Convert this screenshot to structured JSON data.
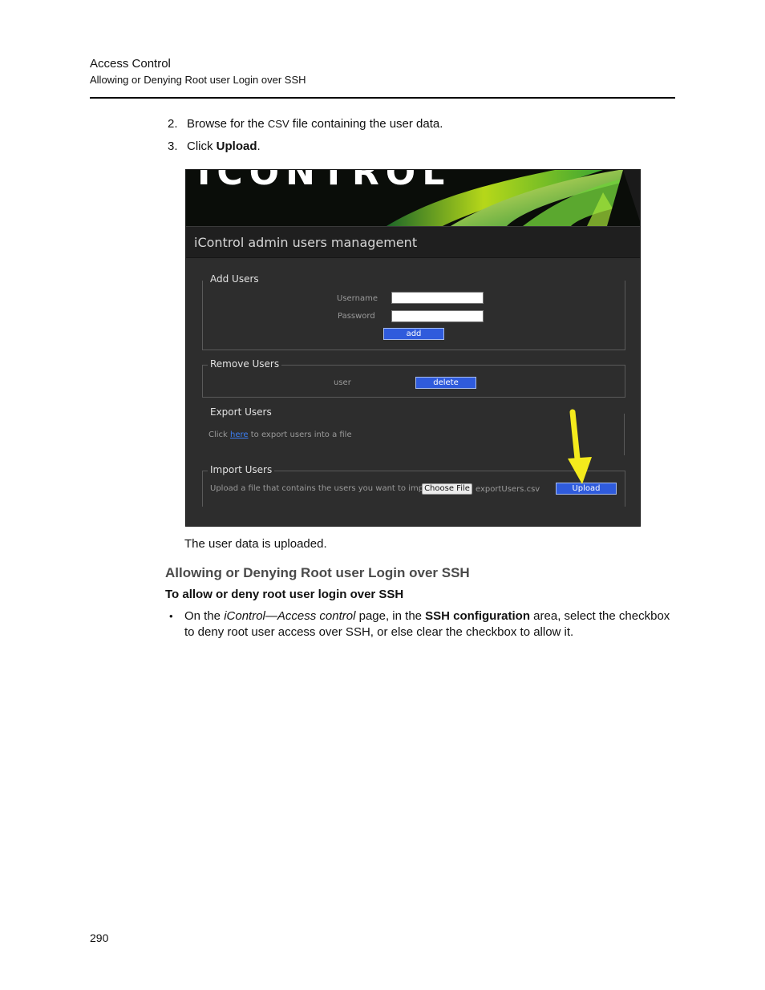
{
  "header": {
    "chapter": "Access Control",
    "section": "Allowing or Denying Root user Login over SSH"
  },
  "steps": [
    {
      "num": "2.",
      "pre": "Browse for the ",
      "code": "CSV",
      "post": " file containing the user data."
    },
    {
      "num": "3.",
      "pre": "Click ",
      "bold": "Upload",
      "post": "."
    }
  ],
  "screenshot": {
    "banner_text": "ICONTROL",
    "app_title": "iControl admin users management",
    "add_users": {
      "legend": "Add Users",
      "username_label": "Username",
      "password_label": "Password",
      "add_button": "add"
    },
    "remove_users": {
      "legend": "Remove Users",
      "user_label": "user",
      "delete_button": "delete"
    },
    "export_users": {
      "legend": "Export Users",
      "text_pre": "Click ",
      "link": "here",
      "text_post": " to export users into a file"
    },
    "import_users": {
      "legend": "Import Users",
      "text": "Upload a file that contains the users you want to import",
      "choose_button": "Choose File",
      "file_name": "exportUsers.csv",
      "upload_button": "Upload"
    },
    "colors": {
      "accent_button": "#2f5bdc",
      "arrow": "#f4ea1c"
    }
  },
  "result_text": "The user data is uploaded.",
  "section_heading": "Allowing or Denying Root user Login over SSH",
  "procedure_heading": "To allow or deny root user login over SSH",
  "bullet": {
    "t1": "On the ",
    "i1": "iControl—Access control",
    "t2": " page, in the ",
    "b1": "SSH  configuration",
    "t3": " area, select the checkbox to deny root user access over SSH, or else clear the checkbox to allow it."
  },
  "page_number": "290"
}
